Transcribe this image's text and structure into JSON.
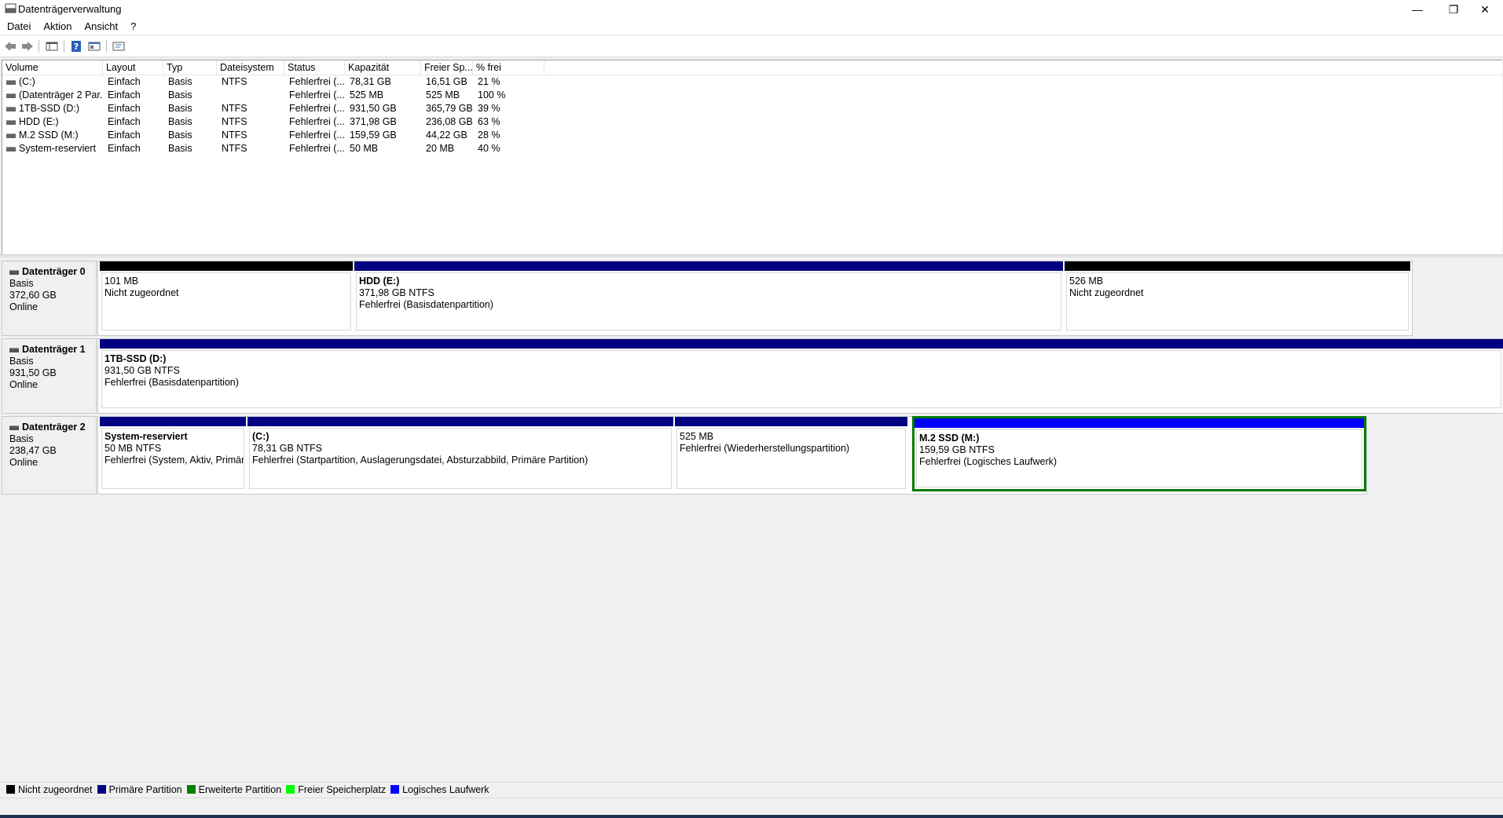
{
  "window": {
    "title": "Datenträgerverwaltung",
    "controls": {
      "minimize": "—",
      "restore": "❐",
      "close": "✕"
    }
  },
  "menu": [
    "Datei",
    "Aktion",
    "Ansicht",
    "?"
  ],
  "toolbar": {
    "buttons": [
      "back-icon",
      "forward-icon",
      "console-tree-icon",
      "help-icon",
      "properties-icon",
      "view-icon"
    ]
  },
  "volumes": {
    "columns": [
      "Volume",
      "Layout",
      "Typ",
      "Dateisystem",
      "Status",
      "Kapazität",
      "Freier Sp...",
      "% frei"
    ],
    "rows": [
      [
        "(C:)",
        "Einfach",
        "Basis",
        "NTFS",
        "Fehlerfrei (...",
        "78,31 GB",
        "16,51 GB",
        "21 %"
      ],
      [
        "(Datenträger 2 Par...",
        "Einfach",
        "Basis",
        "",
        "Fehlerfrei (...",
        "525 MB",
        "525 MB",
        "100 %"
      ],
      [
        "1TB-SSD (D:)",
        "Einfach",
        "Basis",
        "NTFS",
        "Fehlerfrei (...",
        "931,50 GB",
        "365,79 GB",
        "39 %"
      ],
      [
        "HDD (E:)",
        "Einfach",
        "Basis",
        "NTFS",
        "Fehlerfrei (...",
        "371,98 GB",
        "236,08 GB",
        "63 %"
      ],
      [
        "M.2 SSD (M:)",
        "Einfach",
        "Basis",
        "NTFS",
        "Fehlerfrei (...",
        "159,59 GB",
        "44,22 GB",
        "28 %"
      ],
      [
        "System-reserviert",
        "Einfach",
        "Basis",
        "NTFS",
        "Fehlerfrei (...",
        "50 MB",
        "20 MB",
        "40 %"
      ]
    ]
  },
  "disks": [
    {
      "name": "Datenträger 0",
      "type": "Basis",
      "size": "372,60 GB",
      "state": "Online",
      "partitions": [
        {
          "name": "",
          "size": "101 MB",
          "status": "Nicht zugeordnet",
          "color": "#000000"
        },
        {
          "name": "HDD  (E:)",
          "size": "371,98 GB NTFS",
          "status": "Fehlerfrei (Basisdatenpartition)",
          "color": "#000080"
        },
        {
          "name": "",
          "size": "526 MB",
          "status": "Nicht zugeordnet",
          "color": "#000000"
        }
      ]
    },
    {
      "name": "Datenträger 1",
      "type": "Basis",
      "size": "931,50 GB",
      "state": "Online",
      "partitions": [
        {
          "name": "1TB-SSD  (D:)",
          "size": "931,50 GB NTFS",
          "status": "Fehlerfrei (Basisdatenpartition)",
          "color": "#000080"
        }
      ]
    },
    {
      "name": "Datenträger 2",
      "type": "Basis",
      "size": "238,47 GB",
      "state": "Online",
      "partitions": [
        {
          "name": "System-reserviert",
          "size": "50 MB NTFS",
          "status": "Fehlerfrei (System, Aktiv, Primäre",
          "color": "#000080"
        },
        {
          "name": "(C:)",
          "size": "78,31 GB NTFS",
          "status": "Fehlerfrei (Startpartition, Auslagerungsdatei, Absturzabbild, Primäre Partition)",
          "color": "#000080"
        },
        {
          "name": "",
          "size": "525 MB",
          "status": "Fehlerfrei (Wiederherstellungspartition)",
          "color": "#000080"
        },
        {
          "name": "M.2 SSD  (M:)",
          "size": "159,59 GB NTFS",
          "status": "Fehlerfrei (Logisches Laufwerk)",
          "color": "#0000ff"
        }
      ]
    }
  ],
  "legend": [
    {
      "label": "Nicht zugeordnet",
      "color": "#000000"
    },
    {
      "label": "Primäre Partition",
      "color": "#000080"
    },
    {
      "label": "Erweiterte Partition",
      "color": "#008000"
    },
    {
      "label": "Freier Speicherplatz",
      "color": "#00ff00"
    },
    {
      "label": "Logisches Laufwerk",
      "color": "#0000ff"
    }
  ]
}
